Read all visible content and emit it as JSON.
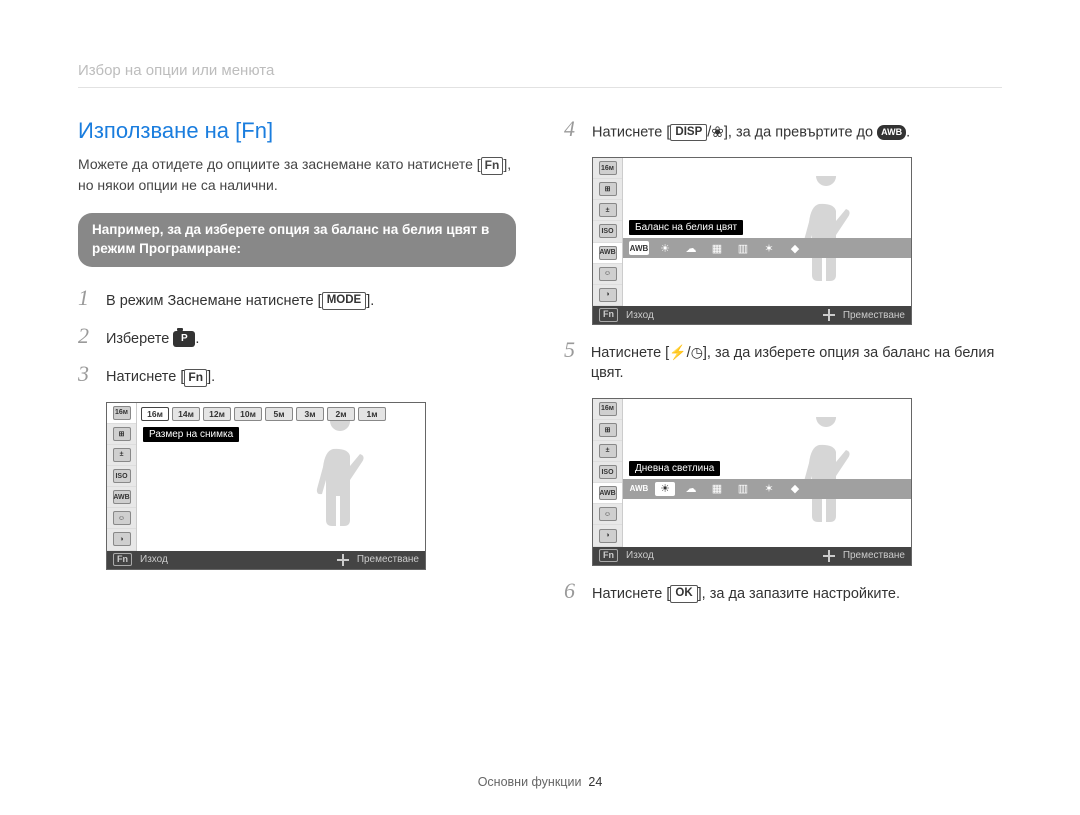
{
  "breadcrumb": "Избор на опции или менюта",
  "title": "Използване на [Fn]",
  "intro_pre": "Можете да отидете до опциите за заснемане като натиснете [",
  "intro_fn": "Fn",
  "intro_post": "], но някои опции не са налични.",
  "tip": "Например, за да изберете опция за баланс на белия цвят в режим Програмиране:",
  "steps_left": [
    {
      "n": "1",
      "pre": "В режим Заснемане натиснете [",
      "btn": "MODE",
      "post": "]."
    },
    {
      "n": "2",
      "pre": "Изберете ",
      "icon": "prog",
      "post": "."
    },
    {
      "n": "3",
      "pre": "Натиснете [",
      "btn": "Fn",
      "post": "]."
    }
  ],
  "lcd1": {
    "tooltip": "Размер на снимка",
    "top": [
      "16м",
      "14м",
      "12м",
      "10м",
      "5м",
      "3м",
      "2м",
      "1м"
    ],
    "bottom_left": "Изход",
    "bottom_right": "Преместване",
    "fn": "Fn"
  },
  "steps_right": [
    {
      "n": "4",
      "pre": "Натиснете [",
      "btn": "DISP",
      "mid": "/",
      "icon": "flower",
      "post": "], за да превъртите до ",
      "pill": "AWB",
      "end": "."
    }
  ],
  "lcd2": {
    "tooltip": "Баланс на белия цвят",
    "bottom_left": "Изход",
    "bottom_right": "Преместване",
    "fn": "Fn"
  },
  "step5": {
    "n": "5",
    "pre": "Натиснете [",
    "icon1": "flash",
    "mid": "/",
    "icon2": "timer",
    "post": "], за да изберете опция за баланс на белия цвят."
  },
  "lcd3": {
    "tooltip": "Дневна светлина",
    "bottom_left": "Изход",
    "bottom_right": "Преместване",
    "fn": "Fn"
  },
  "step6": {
    "n": "6",
    "pre": "Натиснете [",
    "btn": "OK",
    "post": "], за да запазите настройките."
  },
  "sidebar_icons": [
    "16м",
    "⊞",
    "±",
    "ISO",
    "AWB",
    "☺",
    "◑",
    "Fn"
  ],
  "footer": {
    "section": "Основни функции",
    "page": "24"
  }
}
